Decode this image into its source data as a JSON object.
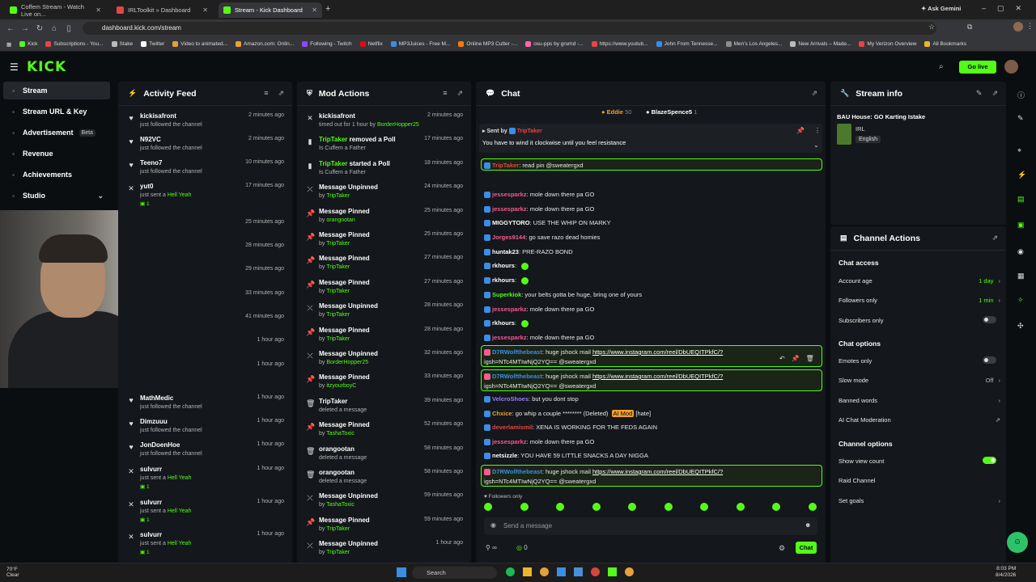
{
  "browser": {
    "tabs": [
      {
        "title": "Coffem Stream - Watch Live on...",
        "active": false,
        "fav": "#53fc18"
      },
      {
        "title": "IRLToolkit » Dashboard",
        "active": false,
        "fav": "#e54545"
      },
      {
        "title": "Stream - Kick Dashboard",
        "active": true,
        "fav": "#53fc18"
      }
    ],
    "ask_gemini": "Ask Gemini",
    "url": "dashboard.kick.com/stream",
    "bookmarks": [
      "Kick",
      "Subscriptions - You...",
      "Stake",
      "Twitter",
      "Video to animated...",
      "Amazon.com: Onlin...",
      "Following - Twitch",
      "Netflix",
      "MP3Juices - Free M...",
      "Online MP3 Cutter -...",
      "osu-pps by grumd -...",
      "https://www.youtub...",
      "John From Tennesse...",
      "Men's Los Angeles...",
      "New Arrivals – Made...",
      "My Verizon Overview",
      "All Bookmarks"
    ]
  },
  "header": {
    "logo": "KICK",
    "go_live": "Go live"
  },
  "sidebar": {
    "items": [
      {
        "label": "Stream",
        "icon": "broadcast-icon"
      },
      {
        "label": "Stream URL & Key",
        "icon": "link-icon"
      },
      {
        "label": "Advertisement",
        "icon": "ad-icon",
        "badge": "Beta"
      },
      {
        "label": "Revenue",
        "icon": "dollar-icon"
      },
      {
        "label": "Achievements",
        "icon": "trophy-icon"
      },
      {
        "label": "Studio",
        "icon": "studio-icon"
      }
    ]
  },
  "activity_feed": {
    "title": "Activity Feed",
    "items": [
      {
        "name": "kickisafront",
        "sub": "just followed the channel",
        "time": "2 minutes ago",
        "icon": "heart-icon"
      },
      {
        "name": "N92VC",
        "sub": "just followed the channel",
        "time": "2 minutes ago",
        "icon": "heart-icon"
      },
      {
        "name": "Teeno7",
        "sub": "just followed the channel",
        "time": "10 minutes ago",
        "icon": "heart-icon"
      },
      {
        "name": "yut0",
        "sub": "just sent a",
        "extra": "Hell Yeah",
        "count": "1",
        "time": "17 minutes ago",
        "icon": "close-icon"
      }
    ],
    "hidden_times": [
      "25 minutes ago",
      "28 minutes ago",
      "29 minutes ago",
      "33 minutes ago",
      "41 minutes ago",
      "1 hour ago",
      "1 hour ago"
    ],
    "items2": [
      {
        "name": "MathMedic",
        "sub": "just followed the channel",
        "time": "1 hour ago",
        "icon": "heart-icon"
      },
      {
        "name": "Dimzuuu",
        "sub": "just followed the channel",
        "time": "1 hour ago",
        "icon": "heart-icon"
      },
      {
        "name": "JonDoenHoe",
        "sub": "just followed the channel",
        "time": "1 hour ago",
        "icon": "heart-icon"
      },
      {
        "name": "sulvurr",
        "sub": "just sent a",
        "extra": "Hell Yeah",
        "count": "1",
        "time": "1 hour ago",
        "icon": "close-icon"
      },
      {
        "name": "sulvurr",
        "sub": "just sent a",
        "extra": "Hell Yeah",
        "count": "1",
        "time": "1 hour ago",
        "icon": "close-icon"
      },
      {
        "name": "sulvurr",
        "sub": "just sent a",
        "extra": "Hell Yeah",
        "count": "1",
        "time": "1 hour ago",
        "icon": "close-icon"
      }
    ]
  },
  "mod_actions": {
    "title": "Mod Actions",
    "items": [
      {
        "name": "kickisafront",
        "sub": "timed out for 1 hour by",
        "by": "BorderHopper25",
        "time": "2 minutes ago",
        "icon": "close-icon"
      },
      {
        "name": "TripTaker",
        "name_green": true,
        "rest": " removed a Poll",
        "sub": "Is Cuffem a Father",
        "time": "17 minutes ago",
        "icon": "poll-icon"
      },
      {
        "name": "TripTaker",
        "name_green": true,
        "rest": " started a Poll",
        "sub": "Is Cuffem a Father",
        "time": "18 minutes ago",
        "icon": "poll-icon"
      },
      {
        "name": "Message Unpinned",
        "sub": "by",
        "by": "TripTaker",
        "time": "24 minutes ago",
        "icon": "unpin-icon"
      },
      {
        "name": "Message Pinned",
        "sub": "by",
        "by": "orangootan",
        "time": "25 minutes ago",
        "icon": "pin-icon"
      },
      {
        "name": "Message Pinned",
        "sub": "by",
        "by": "TripTaker",
        "time": "25 minutes ago",
        "icon": "pin-icon"
      },
      {
        "name": "Message Pinned",
        "sub": "by",
        "by": "TripTaker",
        "time": "27 minutes ago",
        "icon": "pin-icon"
      },
      {
        "name": "Message Pinned",
        "sub": "by",
        "by": "TripTaker",
        "time": "27 minutes ago",
        "icon": "pin-icon"
      },
      {
        "name": "Message Unpinned",
        "sub": "by",
        "by": "TripTaker",
        "time": "28 minutes ago",
        "icon": "unpin-icon"
      },
      {
        "name": "Message Pinned",
        "sub": "by",
        "by": "TripTaker",
        "time": "28 minutes ago",
        "icon": "pin-icon"
      },
      {
        "name": "Message Unpinned",
        "sub": "by",
        "by": "BorderHopper25",
        "time": "32 minutes ago",
        "icon": "unpin-icon"
      },
      {
        "name": "Message Pinned",
        "sub": "by",
        "by": "itzyourboyC",
        "time": "33 minutes ago",
        "icon": "pin-icon"
      },
      {
        "name": "TripTaker",
        "sub": "deleted a message",
        "time": "39 minutes ago",
        "icon": "trash-icon"
      },
      {
        "name": "Message Pinned",
        "sub": "by",
        "by": "TashaToxic",
        "time": "52 minutes ago",
        "icon": "pin-icon"
      },
      {
        "name": "orangootan",
        "sub": "deleted a message",
        "time": "58 minutes ago",
        "icon": "trash-icon"
      },
      {
        "name": "orangootan",
        "sub": "deleted a message",
        "time": "58 minutes ago",
        "icon": "trash-icon"
      },
      {
        "name": "Message Unpinned",
        "sub": "by",
        "by": "TashaToxic",
        "time": "59 minutes ago",
        "icon": "unpin-icon"
      },
      {
        "name": "Message Pinned",
        "sub": "by",
        "by": "TripTaker",
        "time": "59 minutes ago",
        "icon": "pin-icon"
      },
      {
        "name": "Message Unpinned",
        "sub": "by",
        "by": "TripTaker",
        "time": "1 hour ago",
        "icon": "unpin-icon"
      }
    ]
  },
  "chat": {
    "title": "Chat",
    "top_users": [
      {
        "name": "Eddie",
        "count": "50"
      },
      {
        "name": "BlazeSpence5",
        "count": "1"
      }
    ],
    "pinned": {
      "sent_by": "Sent by",
      "user": "TripTaker",
      "text": "You have to wind it clockwise until you feel resistance"
    },
    "messages": [
      {
        "user": "TripTaker",
        "color": "#e54545",
        "text": ": read pin @sweatergxd",
        "hl": true
      },
      {
        "user": "jessesparkz",
        "color": "#f45a8d",
        "text": ": mole down there pa GO"
      },
      {
        "user": "jessesparkz",
        "color": "#f45a8d",
        "text": ": mole down there pa GO"
      },
      {
        "user": "MIGGYTORO",
        "color": "#ffffff",
        "text": ": USE THE WHIP ON MARKY"
      },
      {
        "user": "Jorges9144",
        "color": "#f45a8d",
        "text": ": go save razo dead homies"
      },
      {
        "user": "huntak23",
        "color": "#ffffff",
        "text": ": PRE-RAZO BOND"
      },
      {
        "user": "rkhours",
        "color": "#ffffff",
        "text": ":"
      },
      {
        "user": "rkhours",
        "color": "#ffffff",
        "text": ":"
      },
      {
        "user": "Superkiok",
        "color": "#53fc18",
        "text": ": your belts gotta be huge, bring one of yours"
      },
      {
        "user": "jessesparkz",
        "color": "#f45a8d",
        "text": ": mole down there pa GO"
      },
      {
        "user": "rkhours",
        "color": "#ffffff",
        "text": ":"
      },
      {
        "user": "jessesparkz",
        "color": "#f45a8d",
        "text": ": mole down there pa GO"
      },
      {
        "user": "huntak23",
        "color": "#ffffff",
        "text": ": PRE-RAZO BOND"
      }
    ],
    "link_msg": {
      "user": "D7RWolfthebeast",
      "pre": ": huge jshock mail ",
      "link": "https://www.instagram.com/reel/DbUEQITPkfC/?",
      "line2": "igsh=NTc4MTIwNjQ2YQ== @sweatergxd"
    },
    "messages2": [
      {
        "user": "VelcroShoes",
        "color": "#9b7cff",
        "text": ": but you dont stop"
      },
      {
        "user": "Chxice",
        "color": "#f0a030",
        "text": ": go whip a couple ******** (Deleted) ",
        "ai": "AI Mod",
        "tail": " [hate]"
      },
      {
        "user": "deverlamismil",
        "color": "#e54545",
        "text": ": XENA IS WORKING FOR THE FEDS AGAIN"
      },
      {
        "user": "jessesparkz",
        "color": "#f45a8d",
        "text": ": mole down there pa GO"
      },
      {
        "user": "netsizzle",
        "color": "#ffffff",
        "text": ": YOU HAVE 59 LITTLE SNACKS A DAY NIGGA"
      }
    ],
    "followers_only": "Followers only",
    "placeholder": "Send a message",
    "count": "0",
    "send": "Chat"
  },
  "stream_info": {
    "title": "Stream info",
    "stream_title": "BAU House: GO Karting Istake",
    "category": "IRL",
    "language": "English"
  },
  "channel_actions": {
    "title": "Channel Actions",
    "chat_access": "Chat access",
    "rows1": [
      {
        "label": "Account age",
        "value": "1 day",
        "type": "nav"
      },
      {
        "label": "Followers only",
        "value": "1 min",
        "type": "nav"
      },
      {
        "label": "Subscribers only",
        "type": "toggle",
        "on": false
      }
    ],
    "chat_options": "Chat options",
    "rows2": [
      {
        "label": "Emotes only",
        "type": "toggle",
        "on": false
      },
      {
        "label": "Slow mode",
        "value": "Off",
        "type": "nav"
      },
      {
        "label": "Banned words",
        "type": "nav"
      },
      {
        "label": "AI Chat Moderation",
        "type": "ext"
      }
    ],
    "channel_options": "Channel options",
    "rows3": [
      {
        "label": "Show view count",
        "type": "toggle",
        "on": true
      },
      {
        "label": "Raid Channel",
        "type": "none"
      },
      {
        "label": "Set goals",
        "type": "nav"
      }
    ]
  },
  "taskbar": {
    "weather_temp": "70°F",
    "weather_desc": "Clear",
    "search": "Search",
    "time": "8:03 PM",
    "date": "8/4/2026"
  }
}
